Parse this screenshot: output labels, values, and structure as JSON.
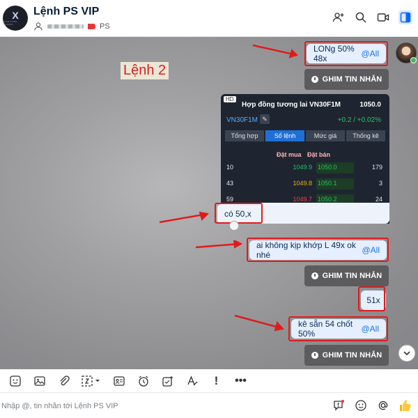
{
  "header": {
    "title": "Lệnh PS VIP",
    "avatar_text": "X",
    "avatar_subtext": "XUAN CHINH TRADING",
    "tag_label": "PS"
  },
  "chat": {
    "annotation": "Lệnh 2",
    "messages": [
      {
        "text": "LONg 50% 48x",
        "mention": "@All"
      },
      {
        "pin_label": "GHIM TIN NHẮN"
      },
      {
        "text": "có 50,x"
      },
      {
        "text": "ai không kịp khớp L 49x ok nhé",
        "mention": "@All"
      },
      {
        "pin_label": "GHIM TIN NHẮN"
      },
      {
        "text": "51x"
      },
      {
        "text": "kê sẵn 54 chốt 50%",
        "mention": "@All"
      },
      {
        "pin_label": "GHIM TIN NHẮN"
      }
    ]
  },
  "card": {
    "hd_badge": "HD",
    "title": "Hợp đồng tương lai VN30F1M",
    "price": "1050.0",
    "symbol": "VN30F1M",
    "change": "+0.2 / +0.02%",
    "tabs": [
      "Tổng hợp",
      "Sổ lệnh",
      "Mức giá",
      "Thống kê"
    ],
    "selected_tab": "Sổ lệnh",
    "col_buy": "Đặt mua",
    "col_sell": "Đặt bán",
    "rows": [
      {
        "vol_buy": "10",
        "buy": "1049.9",
        "sell": "1050.0",
        "vol_sell": "179",
        "buy_color": "#22c55e"
      },
      {
        "vol_buy": "43",
        "buy": "1049.8",
        "sell": "1050.1",
        "vol_sell": "3",
        "buy_color": "#eab308"
      },
      {
        "vol_buy": "59",
        "buy": "1049.7",
        "sell": "1050.2",
        "vol_sell": "24",
        "buy_color": "#ef4444"
      }
    ]
  },
  "composer": {
    "placeholder": "Nhập @, tin nhắn tới Lệnh PS VIP"
  },
  "colors": {
    "annotation_red": "#e01b1b",
    "bubble_bg": "#e5efff",
    "mention_blue": "#1a73e8",
    "pin_bg": "#5c5c5f"
  }
}
